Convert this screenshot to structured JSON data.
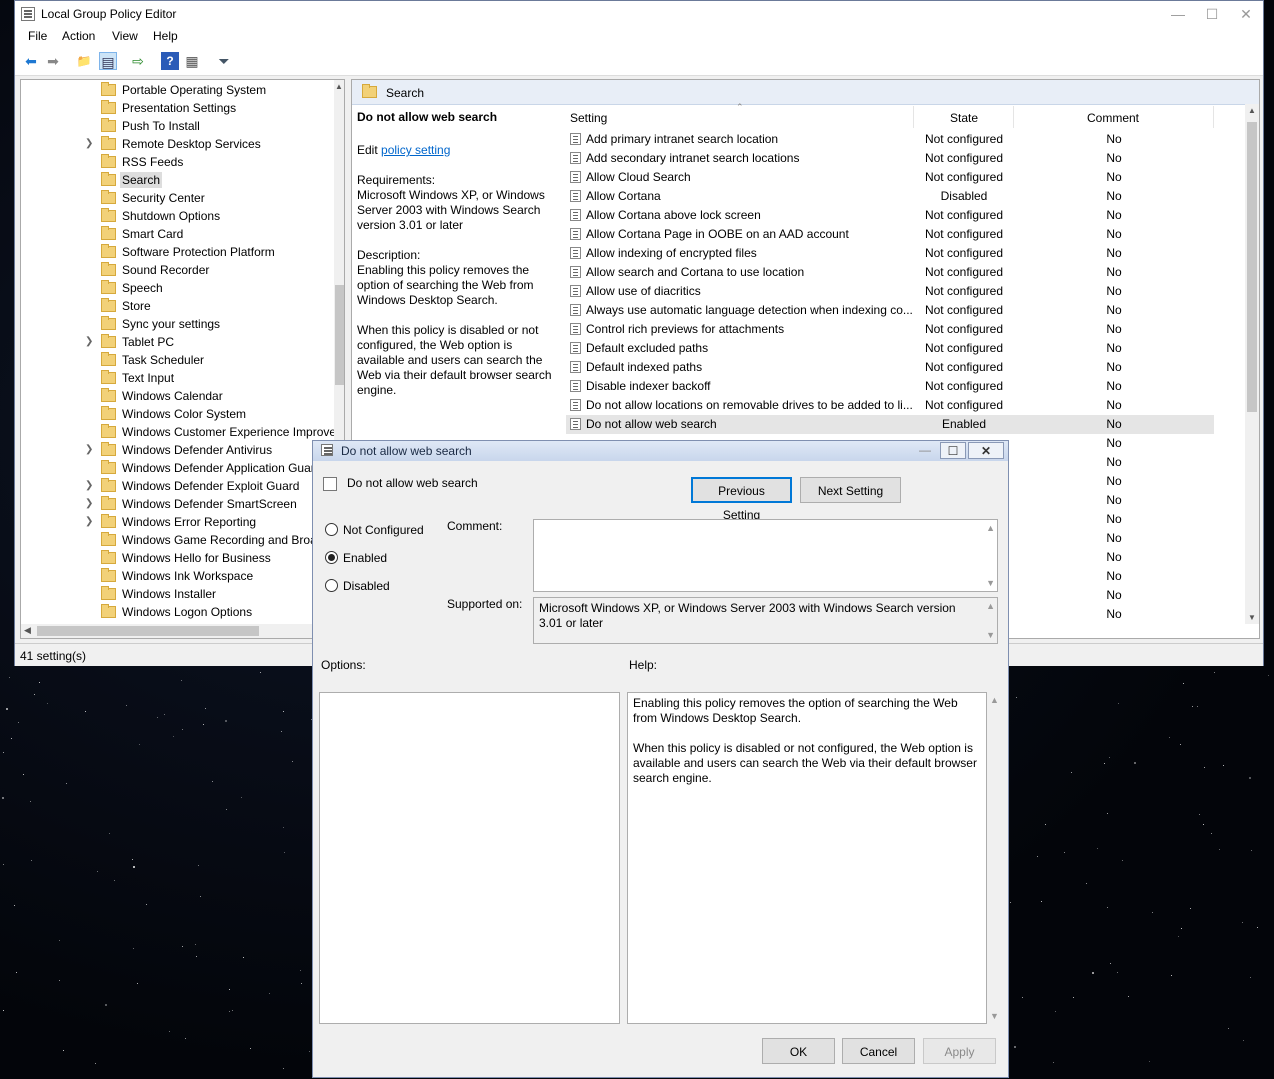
{
  "window": {
    "title": "Local Group Policy Editor",
    "controls": {
      "minimize": "—",
      "maximize": "☐",
      "close": "✕"
    }
  },
  "menubar": {
    "items": [
      "File",
      "Action",
      "View",
      "Help"
    ]
  },
  "toolbar": {
    "icons": [
      "back-icon",
      "forward-icon",
      "up-folder-icon",
      "show-hide-tree-icon",
      "export-list-icon",
      "help-icon",
      "properties-icon",
      "filter-icon"
    ],
    "glyphs": [
      "⬅",
      "➡",
      "📁",
      "▤",
      "⇨",
      "?",
      "▦",
      "⏷"
    ]
  },
  "tree": {
    "items": [
      {
        "label": "Portable Operating System",
        "expandable": false,
        "selected": false
      },
      {
        "label": "Presentation Settings",
        "expandable": false,
        "selected": false
      },
      {
        "label": "Push To Install",
        "expandable": false,
        "selected": false
      },
      {
        "label": "Remote Desktop Services",
        "expandable": true,
        "selected": false
      },
      {
        "label": "RSS Feeds",
        "expandable": false,
        "selected": false
      },
      {
        "label": "Search",
        "expandable": false,
        "selected": true
      },
      {
        "label": "Security Center",
        "expandable": false,
        "selected": false
      },
      {
        "label": "Shutdown Options",
        "expandable": false,
        "selected": false
      },
      {
        "label": "Smart Card",
        "expandable": false,
        "selected": false
      },
      {
        "label": "Software Protection Platform",
        "expandable": false,
        "selected": false
      },
      {
        "label": "Sound Recorder",
        "expandable": false,
        "selected": false
      },
      {
        "label": "Speech",
        "expandable": false,
        "selected": false
      },
      {
        "label": "Store",
        "expandable": false,
        "selected": false
      },
      {
        "label": "Sync your settings",
        "expandable": false,
        "selected": false
      },
      {
        "label": "Tablet PC",
        "expandable": true,
        "selected": false
      },
      {
        "label": "Task Scheduler",
        "expandable": false,
        "selected": false
      },
      {
        "label": "Text Input",
        "expandable": false,
        "selected": false
      },
      {
        "label": "Windows Calendar",
        "expandable": false,
        "selected": false
      },
      {
        "label": "Windows Color System",
        "expandable": false,
        "selected": false
      },
      {
        "label": "Windows Customer Experience Improve",
        "expandable": false,
        "selected": false
      },
      {
        "label": "Windows Defender Antivirus",
        "expandable": true,
        "selected": false
      },
      {
        "label": "Windows Defender Application Guar",
        "expandable": false,
        "selected": false
      },
      {
        "label": "Windows Defender Exploit Guard",
        "expandable": true,
        "selected": false
      },
      {
        "label": "Windows Defender SmartScreen",
        "expandable": true,
        "selected": false
      },
      {
        "label": "Windows Error Reporting",
        "expandable": true,
        "selected": false
      },
      {
        "label": "Windows Game Recording and Broa",
        "expandable": false,
        "selected": false
      },
      {
        "label": "Windows Hello for Business",
        "expandable": false,
        "selected": false
      },
      {
        "label": "Windows Ink Workspace",
        "expandable": false,
        "selected": false
      },
      {
        "label": "Windows Installer",
        "expandable": false,
        "selected": false
      },
      {
        "label": "Windows Logon Options",
        "expandable": false,
        "selected": false
      }
    ]
  },
  "right_pane": {
    "header_title": "Search",
    "extended": {
      "title": "Do not allow web search",
      "edit_prefix": "Edit ",
      "edit_link": "policy setting",
      "requirements_label": "Requirements:",
      "requirements_text": "Microsoft Windows XP, or Windows Server 2003 with Windows Search version 3.01 or later",
      "description_label": "Description:",
      "description_p1": "Enabling this policy removes the option of searching the Web from Windows Desktop Search.",
      "description_p2": "When this policy is disabled or not configured, the Web option is available and users can search the Web via their default browser search engine."
    },
    "columns": {
      "setting": "Setting",
      "state": "State",
      "comment": "Comment"
    },
    "rows": [
      {
        "name": "Add primary intranet search location",
        "state": "Not configured",
        "comment": "No"
      },
      {
        "name": "Add secondary intranet search locations",
        "state": "Not configured",
        "comment": "No"
      },
      {
        "name": "Allow Cloud Search",
        "state": "Not configured",
        "comment": "No"
      },
      {
        "name": "Allow Cortana",
        "state": "Disabled",
        "comment": "No"
      },
      {
        "name": "Allow Cortana above lock screen",
        "state": "Not configured",
        "comment": "No"
      },
      {
        "name": "Allow Cortana Page in OOBE on an AAD account",
        "state": "Not configured",
        "comment": "No"
      },
      {
        "name": "Allow indexing of encrypted files",
        "state": "Not configured",
        "comment": "No"
      },
      {
        "name": "Allow search and Cortana to use location",
        "state": "Not configured",
        "comment": "No"
      },
      {
        "name": "Allow use of diacritics",
        "state": "Not configured",
        "comment": "No"
      },
      {
        "name": "Always use automatic language detection when indexing co...",
        "state": "Not configured",
        "comment": "No"
      },
      {
        "name": "Control rich previews for attachments",
        "state": "Not configured",
        "comment": "No"
      },
      {
        "name": "Default excluded paths",
        "state": "Not configured",
        "comment": "No"
      },
      {
        "name": "Default indexed paths",
        "state": "Not configured",
        "comment": "No"
      },
      {
        "name": "Disable indexer backoff",
        "state": "Not configured",
        "comment": "No"
      },
      {
        "name": "Do not allow locations on removable drives to be added to li...",
        "state": "Not configured",
        "comment": "No"
      },
      {
        "name": "Do not allow web search",
        "state": "Enabled",
        "comment": "No"
      },
      {
        "name": "",
        "state": "",
        "comment": "No"
      },
      {
        "name": "",
        "state": "",
        "comment": "No"
      },
      {
        "name": "",
        "state": "",
        "comment": "No"
      },
      {
        "name": "",
        "state": "",
        "comment": "No"
      },
      {
        "name": "",
        "state": "",
        "comment": "No"
      },
      {
        "name": "",
        "state": "",
        "comment": "No"
      },
      {
        "name": "",
        "state": "",
        "comment": "No"
      },
      {
        "name": "",
        "state": "",
        "comment": "No"
      },
      {
        "name": "",
        "state": "",
        "comment": "No"
      },
      {
        "name": "",
        "state": "",
        "comment": "No"
      }
    ],
    "selected_row": 15
  },
  "status": {
    "text": "41 setting(s)"
  },
  "dialog": {
    "title": "Do not allow web search",
    "header_text": "Do not allow web search",
    "previous_setting": "Previous Setting",
    "next_setting": "Next Setting",
    "radio": {
      "not_configured": "Not Configured",
      "enabled": "Enabled",
      "disabled": "Disabled",
      "selected": "enabled"
    },
    "comment_label": "Comment:",
    "comment_value": "",
    "supported_label": "Supported on:",
    "supported_value": "Microsoft Windows XP, or Windows Server 2003 with Windows Search version 3.01 or later",
    "options_label": "Options:",
    "help_label": "Help:",
    "help_p1": "Enabling this policy removes the option of searching the Web from Windows Desktop Search.",
    "help_p2": "When this policy is disabled or not configured, the Web option is available and users can search the Web via their default browser search engine.",
    "ok": "OK",
    "cancel": "Cancel",
    "apply": "Apply"
  }
}
